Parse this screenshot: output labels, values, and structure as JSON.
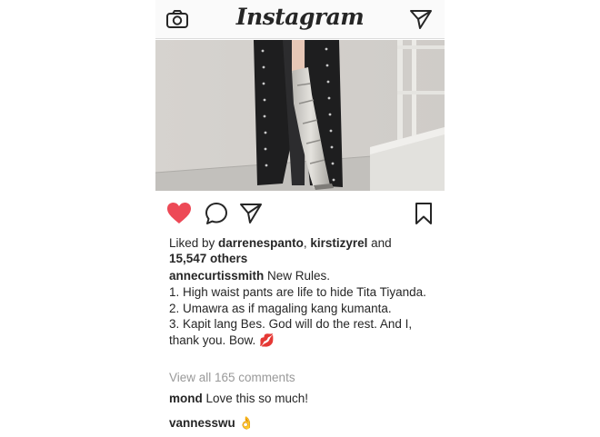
{
  "header": {
    "logo": "Instagram"
  },
  "post": {
    "liked_by_prefix": "Liked by ",
    "liked_user_1": "darrenespanto",
    "liked_sep": ", ",
    "liked_user_2": "kirstizyrel",
    "liked_and": " and",
    "liked_others": "15,547 others",
    "author": "annecurtissmith",
    "caption_line_1": " New Rules.",
    "caption_line_2": "1. High waist pants are life to hide Tita Tiyanda.",
    "caption_line_3": "2. Umawra as if magaling kang kumanta.",
    "caption_line_4": "3. Kapit lang Bes. God will do the rest. And I, thank you. Bow.",
    "caption_emoji": "💋",
    "view_all_comments": "View all 165 comments",
    "comments": [
      {
        "user": "mond",
        "text": " Love this so much!"
      },
      {
        "user": "vannesswu",
        "text": "",
        "emoji": "👌"
      }
    ],
    "liked": true
  },
  "colors": {
    "heart": "#ed4956",
    "icon": "#262626",
    "muted": "#999999"
  },
  "icons": {
    "camera": "camera-icon",
    "direct": "paper-plane-icon",
    "like": "heart-icon",
    "comment": "comment-bubble-icon",
    "share": "share-icon",
    "save": "bookmark-icon"
  }
}
